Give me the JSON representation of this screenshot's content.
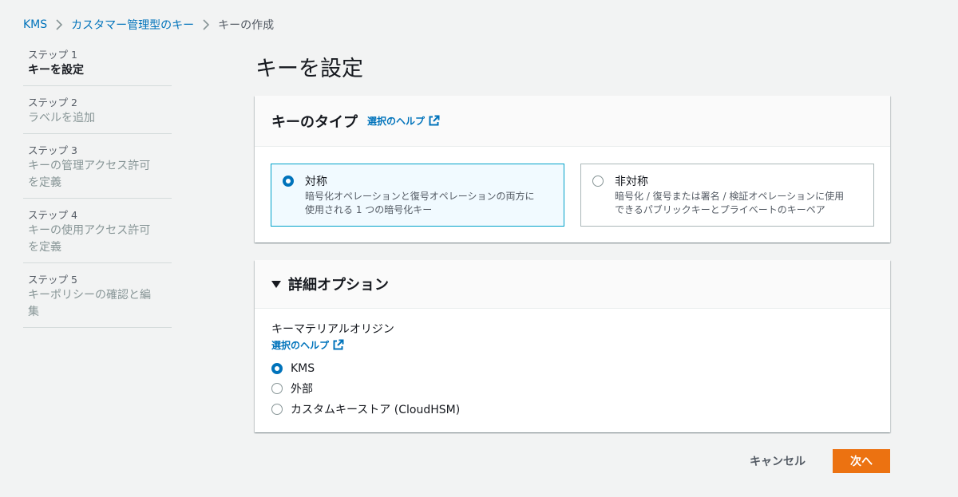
{
  "breadcrumb": {
    "items": [
      "KMS",
      "カスタマー管理型のキー",
      "キーの作成"
    ]
  },
  "steps": [
    {
      "num": "ステップ 1",
      "label": "キーを設定"
    },
    {
      "num": "ステップ 2",
      "label": "ラベルを追加"
    },
    {
      "num": "ステップ 3",
      "label": "キーの管理アクセス許可を定義"
    },
    {
      "num": "ステップ 4",
      "label": "キーの使用アクセス許可を定義"
    },
    {
      "num": "ステップ 5",
      "label": "キーポリシーの確認と編集"
    }
  ],
  "page_title": "キーを設定",
  "key_type": {
    "title": "キーのタイプ",
    "help": "選択のヘルプ",
    "options": [
      {
        "label": "対称",
        "desc_line1": "暗号化オペレーションと復号オペレーションの両方に",
        "desc_line2": "使用される 1 つの暗号化キー",
        "selected": true
      },
      {
        "label": "非対称",
        "desc_line1": "暗号化 / 復号または署名 / 検証オペレーションに使用",
        "desc_line2": "できるパブリックキーとプライベートのキーペア",
        "selected": false
      }
    ]
  },
  "advanced": {
    "title": "詳細オプション",
    "field_label": "キーマテリアルオリジン",
    "help": "選択のヘルプ",
    "options": [
      "KMS",
      "外部",
      "カスタムキーストア (CloudHSM)"
    ],
    "selected_index": 0
  },
  "footer": {
    "cancel": "キャンセル",
    "next": "次へ"
  },
  "colors": {
    "accent": "#0073bb",
    "primary_button": "#ec7211",
    "selected_tile_bg": "#f1faff"
  }
}
